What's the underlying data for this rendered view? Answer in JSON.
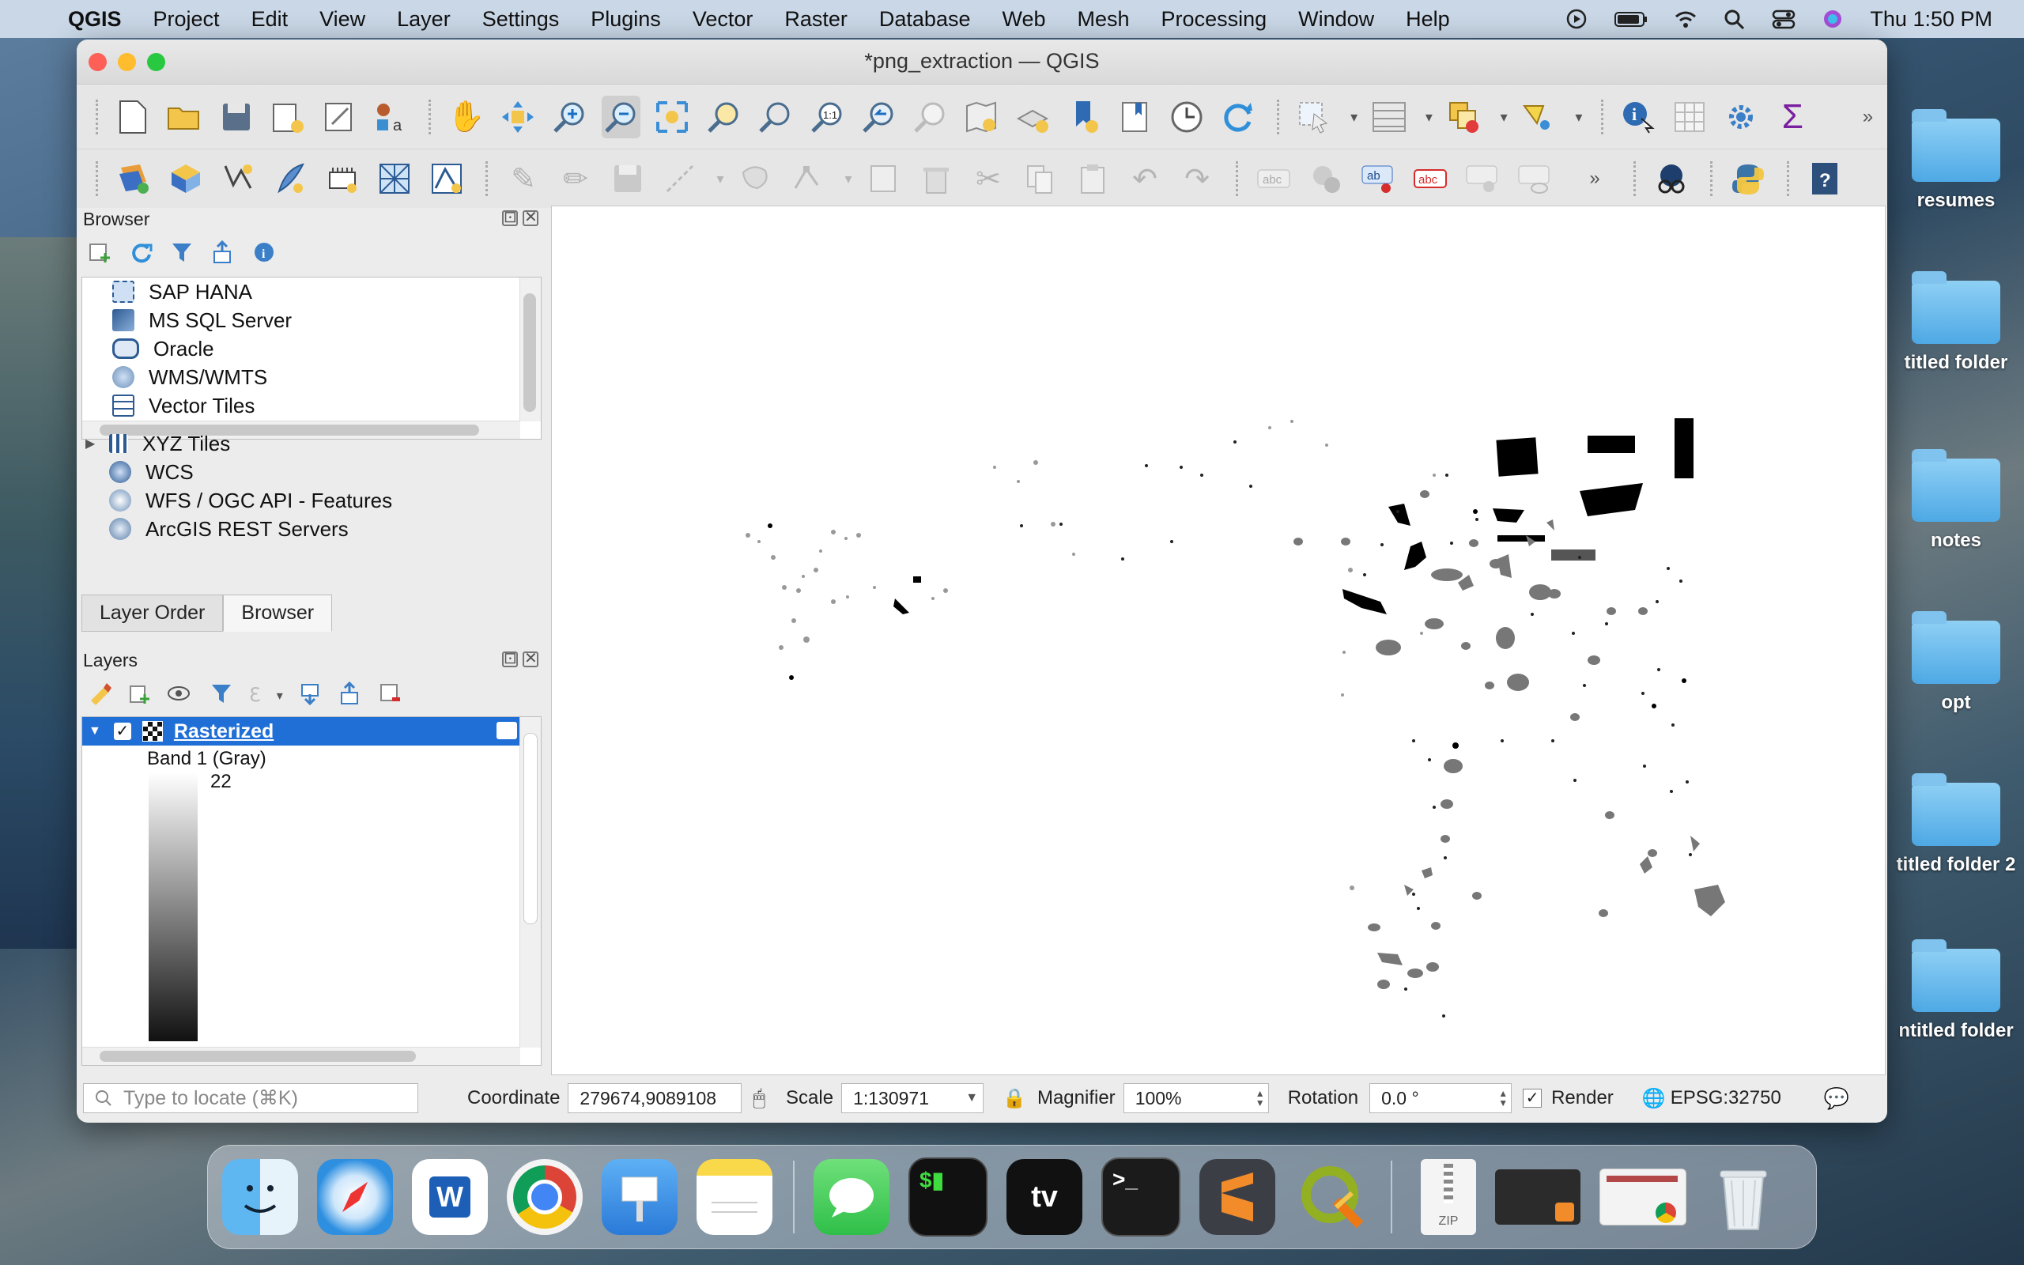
{
  "menubar": {
    "app_name": "QGIS",
    "items": [
      "Project",
      "Edit",
      "View",
      "Layer",
      "Settings",
      "Plugins",
      "Vector",
      "Raster",
      "Database",
      "Web",
      "Mesh",
      "Processing",
      "Window",
      "Help"
    ],
    "clock": "Thu  1:50 PM"
  },
  "window": {
    "title": "*png_extraction — QGIS"
  },
  "browser_panel": {
    "title": "Browser",
    "items": [
      {
        "label": "SAP HANA",
        "icon": "sap-hana-icon"
      },
      {
        "label": "MS SQL Server",
        "icon": "mssql-icon"
      },
      {
        "label": "Oracle",
        "icon": "oracle-icon"
      },
      {
        "label": "WMS/WMTS",
        "icon": "wms-icon"
      },
      {
        "label": "Vector Tiles",
        "icon": "vector-tiles-icon"
      },
      {
        "label": "XYZ Tiles",
        "icon": "xyz-tiles-icon"
      },
      {
        "label": "WCS",
        "icon": "wcs-icon"
      },
      {
        "label": "WFS / OGC API - Features",
        "icon": "wfs-icon"
      },
      {
        "label": "ArcGIS REST Servers",
        "icon": "arcgis-icon"
      }
    ],
    "tabs": [
      "Layer Order",
      "Browser"
    ]
  },
  "layers_panel": {
    "title": "Layers",
    "layer_name": "Rasterized",
    "band_label": "Band 1 (Gray)",
    "legend_value": "22"
  },
  "statusbar": {
    "locator_placeholder": "Type to locate (⌘K)",
    "coordinate_label": "Coordinate",
    "coordinate_value": "279674,9089108",
    "scale_label": "Scale",
    "scale_value": "1:130971",
    "magnifier_label": "Magnifier",
    "magnifier_value": "100%",
    "rotation_label": "Rotation",
    "rotation_value": "0.0 °",
    "render_label": "Render",
    "crs": "EPSG:32750"
  },
  "desktop_icons": [
    "resumes",
    "titled folder",
    "notes",
    "opt",
    "titled folder 2",
    "ntitled folder"
  ],
  "dock_zip_label": "ZIP"
}
